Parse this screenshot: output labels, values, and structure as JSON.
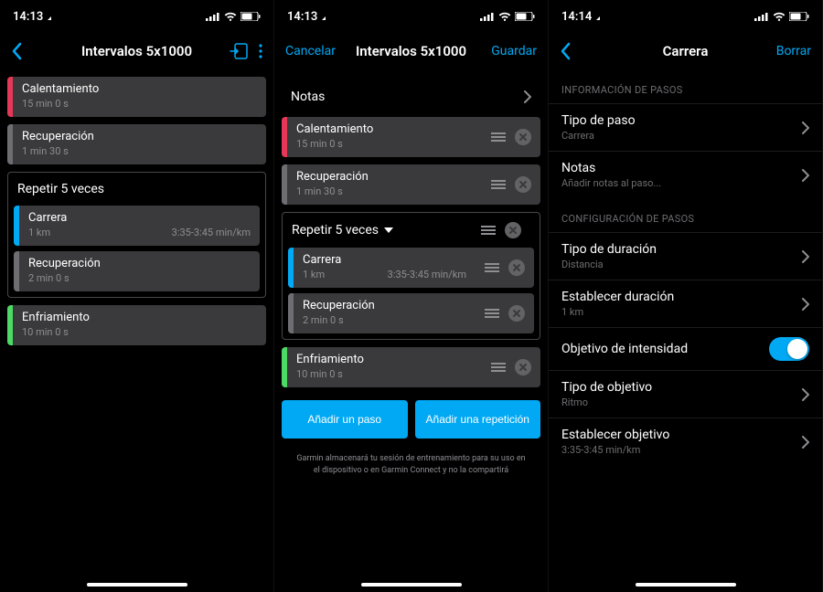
{
  "status": {
    "time_a": "14:13",
    "time_b": "14:13",
    "time_c": "14:14"
  },
  "screen1": {
    "title": "Intervalos 5x1000",
    "steps": [
      {
        "barClass": "bar-red",
        "title": "Calentamiento",
        "sub": "15 min 0 s"
      },
      {
        "barClass": "bar-gray",
        "title": "Recuperación",
        "sub": "1 min 30 s"
      }
    ],
    "repeat_label": "Repetir 5 veces",
    "repeat_steps": [
      {
        "barClass": "bar-blue",
        "title": "Carrera",
        "sub": "1 km",
        "extra": "3:35-3:45 min/km"
      },
      {
        "barClass": "bar-gray",
        "title": "Recuperación",
        "sub": "2 min 0 s"
      }
    ],
    "post_steps": [
      {
        "barClass": "bar-green",
        "title": "Enfriamiento",
        "sub": "10 min 0 s"
      }
    ]
  },
  "screen2": {
    "cancel": "Cancelar",
    "save": "Guardar",
    "title": "Intervalos 5x1000",
    "notes": "Notas",
    "steps": [
      {
        "barClass": "bar-red",
        "title": "Calentamiento",
        "sub": "15 min 0 s"
      },
      {
        "barClass": "bar-gray",
        "title": "Recuperación",
        "sub": "1 min 30 s"
      }
    ],
    "repeat_label": "Repetir 5 veces",
    "repeat_steps": [
      {
        "barClass": "bar-blue",
        "title": "Carrera",
        "sub": "1 km",
        "extra": "3:35-3:45 min/km"
      },
      {
        "barClass": "bar-gray",
        "title": "Recuperación",
        "sub": "2 min 0 s"
      }
    ],
    "post_steps": [
      {
        "barClass": "bar-green",
        "title": "Enfriamiento",
        "sub": "10 min 0 s"
      }
    ],
    "add_step": "Añadir un paso",
    "add_repeat": "Añadir una repetición",
    "footnote": "Garmin almacenará tu sesión de entrenamiento para su uso en el dispositivo o en Garmin Connect y no la compartirá"
  },
  "screen3": {
    "title": "Carrera",
    "delete": "Borrar",
    "section1": "Información de pasos",
    "rows1": [
      {
        "title": "Tipo de paso",
        "sub": "Carrera"
      },
      {
        "title": "Notas",
        "sub": "Añadir notas al paso..."
      }
    ],
    "section2": "Configuración de pasos",
    "rows2": [
      {
        "title": "Tipo de duración",
        "sub": "Distancia",
        "chevron": true
      },
      {
        "title": "Establecer duración",
        "sub": "1 km",
        "chevron": true
      },
      {
        "title": "Objetivo de intensidad",
        "toggle": true
      },
      {
        "title": "Tipo de objetivo",
        "sub": "Ritmo",
        "chevron": true
      },
      {
        "title": "Establecer objetivo",
        "sub": "3:35-3:45 min/km",
        "chevron": true
      }
    ]
  }
}
